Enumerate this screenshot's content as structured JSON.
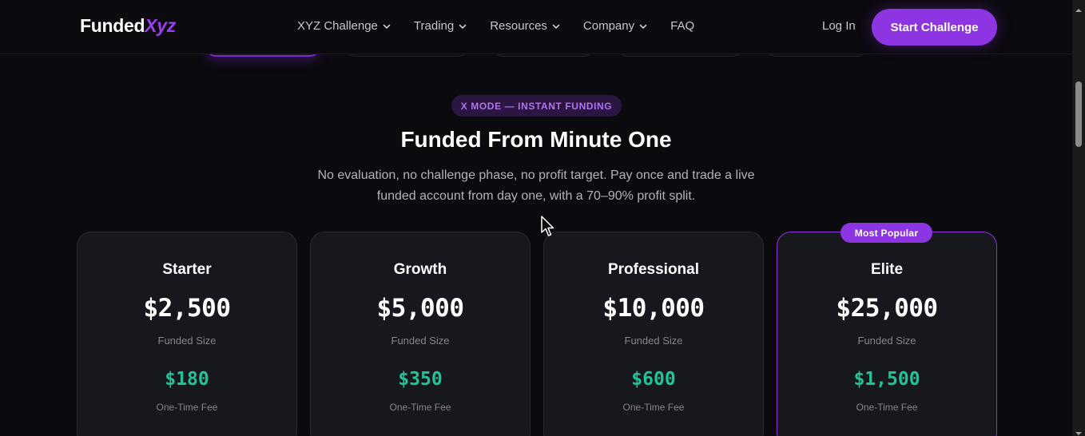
{
  "brand": {
    "name_main": "Funded",
    "name_accent": "Xyz"
  },
  "nav": {
    "links": [
      {
        "label": "XYZ Challenge",
        "has_dropdown": true
      },
      {
        "label": "Trading",
        "has_dropdown": true
      },
      {
        "label": "Resources",
        "has_dropdown": true
      },
      {
        "label": "Company",
        "has_dropdown": true
      },
      {
        "label": "FAQ",
        "has_dropdown": false
      }
    ],
    "login_label": "Log In",
    "cta_label": "Start Challenge"
  },
  "hero": {
    "badge": "X MODE — INSTANT FUNDING",
    "title": "Funded From Minute One",
    "subtitle": "No evaluation, no challenge phase, no profit target. Pay once and trade a live funded account from day one, with a 70–90% profit split."
  },
  "plans": [
    {
      "name": "Starter",
      "size": "$2,500",
      "size_label": "Funded Size",
      "fee": "$180",
      "fee_label": "One-Time Fee",
      "popular": false
    },
    {
      "name": "Growth",
      "size": "$5,000",
      "size_label": "Funded Size",
      "fee": "$350",
      "fee_label": "One-Time Fee",
      "popular": false
    },
    {
      "name": "Professional",
      "size": "$10,000",
      "size_label": "Funded Size",
      "fee": "$600",
      "fee_label": "One-Time Fee",
      "popular": false
    },
    {
      "name": "Elite",
      "size": "$25,000",
      "size_label": "Funded Size",
      "fee": "$1,500",
      "fee_label": "One-Time Fee",
      "popular": true
    }
  ],
  "popular_tag": "Most Popular",
  "colors": {
    "background": "#0b0a0f",
    "accent_purple": "#8e35e3",
    "fee_green": "#1fc598",
    "card_bg": "#17171e"
  },
  "icons": {
    "dropdown": "chevron-down-icon",
    "cursor": "mouse-pointer-icon"
  }
}
